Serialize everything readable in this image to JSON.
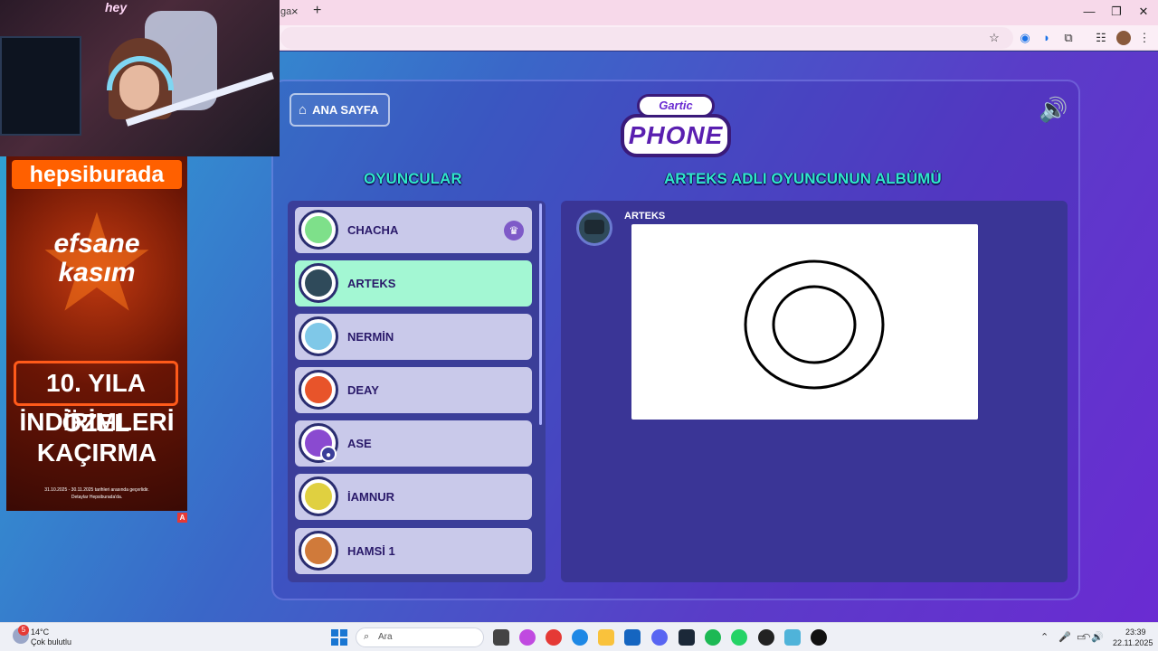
{
  "browser": {
    "tab_partial": "ga",
    "tab_close": "×",
    "tab_new": "+",
    "win_min": "—",
    "win_restore": "❐",
    "win_close": "✕",
    "icons": [
      "star-icon",
      "extension-icon",
      "media-icon",
      "puzzle-icon",
      "menu-icon"
    ],
    "toolbar_icons": {
      "bookmark": "☆",
      "ext1": "◉",
      "media": "◗",
      "extensions": "⧉",
      "reading": "☷",
      "menu": "⋮"
    }
  },
  "game": {
    "home_label": "ANA SAYFA",
    "home_icon": "⌂",
    "logo_top": "Gartic",
    "logo_bottom": "PHONE",
    "sound_icon": "🔊",
    "players_title": "OYUNCULAR",
    "album_title": "ARTEKS ADLI OYUNCUNUN ALBÜMÜ",
    "crown_icon": "♛",
    "sub_icon": "●",
    "players": [
      {
        "name": "CHACHA",
        "active": false,
        "color": "#7ee08a",
        "owner": true
      },
      {
        "name": "ARTEKS",
        "active": true,
        "color": "#2f4a5a"
      },
      {
        "name": "NERMİN",
        "active": false,
        "color": "#7fc8e8"
      },
      {
        "name": "DEAY",
        "active": false,
        "color": "#e8542a"
      },
      {
        "name": "ASE",
        "active": false,
        "color": "#8a4ad0",
        "sub": true
      },
      {
        "name": "İAMNUR",
        "active": false,
        "color": "#e0d040"
      },
      {
        "name": "HAMSİ 1",
        "active": false,
        "color": "#d07a3a"
      }
    ],
    "album": {
      "author": "ARTEKS"
    }
  },
  "stream": {
    "neon": "hey",
    "ad": {
      "brand": "hepsiburada",
      "star_line1": "efsane",
      "star_line2": "kasım",
      "box": "10. YILA ÖZEL",
      "line2": "İNDİRİMLERİ",
      "line3": "KAÇIRMA",
      "small1": "31.10.2025 - 30.11.2025 tarihleri arasında geçerlidir.",
      "small2": "Detaylar Hepsiburada'da.",
      "corner": "A"
    }
  },
  "taskbar": {
    "weather_badge": "5",
    "temp": "14°C",
    "condition": "Çok bulutlu",
    "search_icon": "⌕",
    "search_placeholder": "Ara",
    "sys": {
      "chevron": "⌃",
      "mic": "🎤",
      "display": "▭",
      "wifi": "◠",
      "volume": "🔊"
    },
    "time": "23:39",
    "date": "22.11.2025"
  }
}
